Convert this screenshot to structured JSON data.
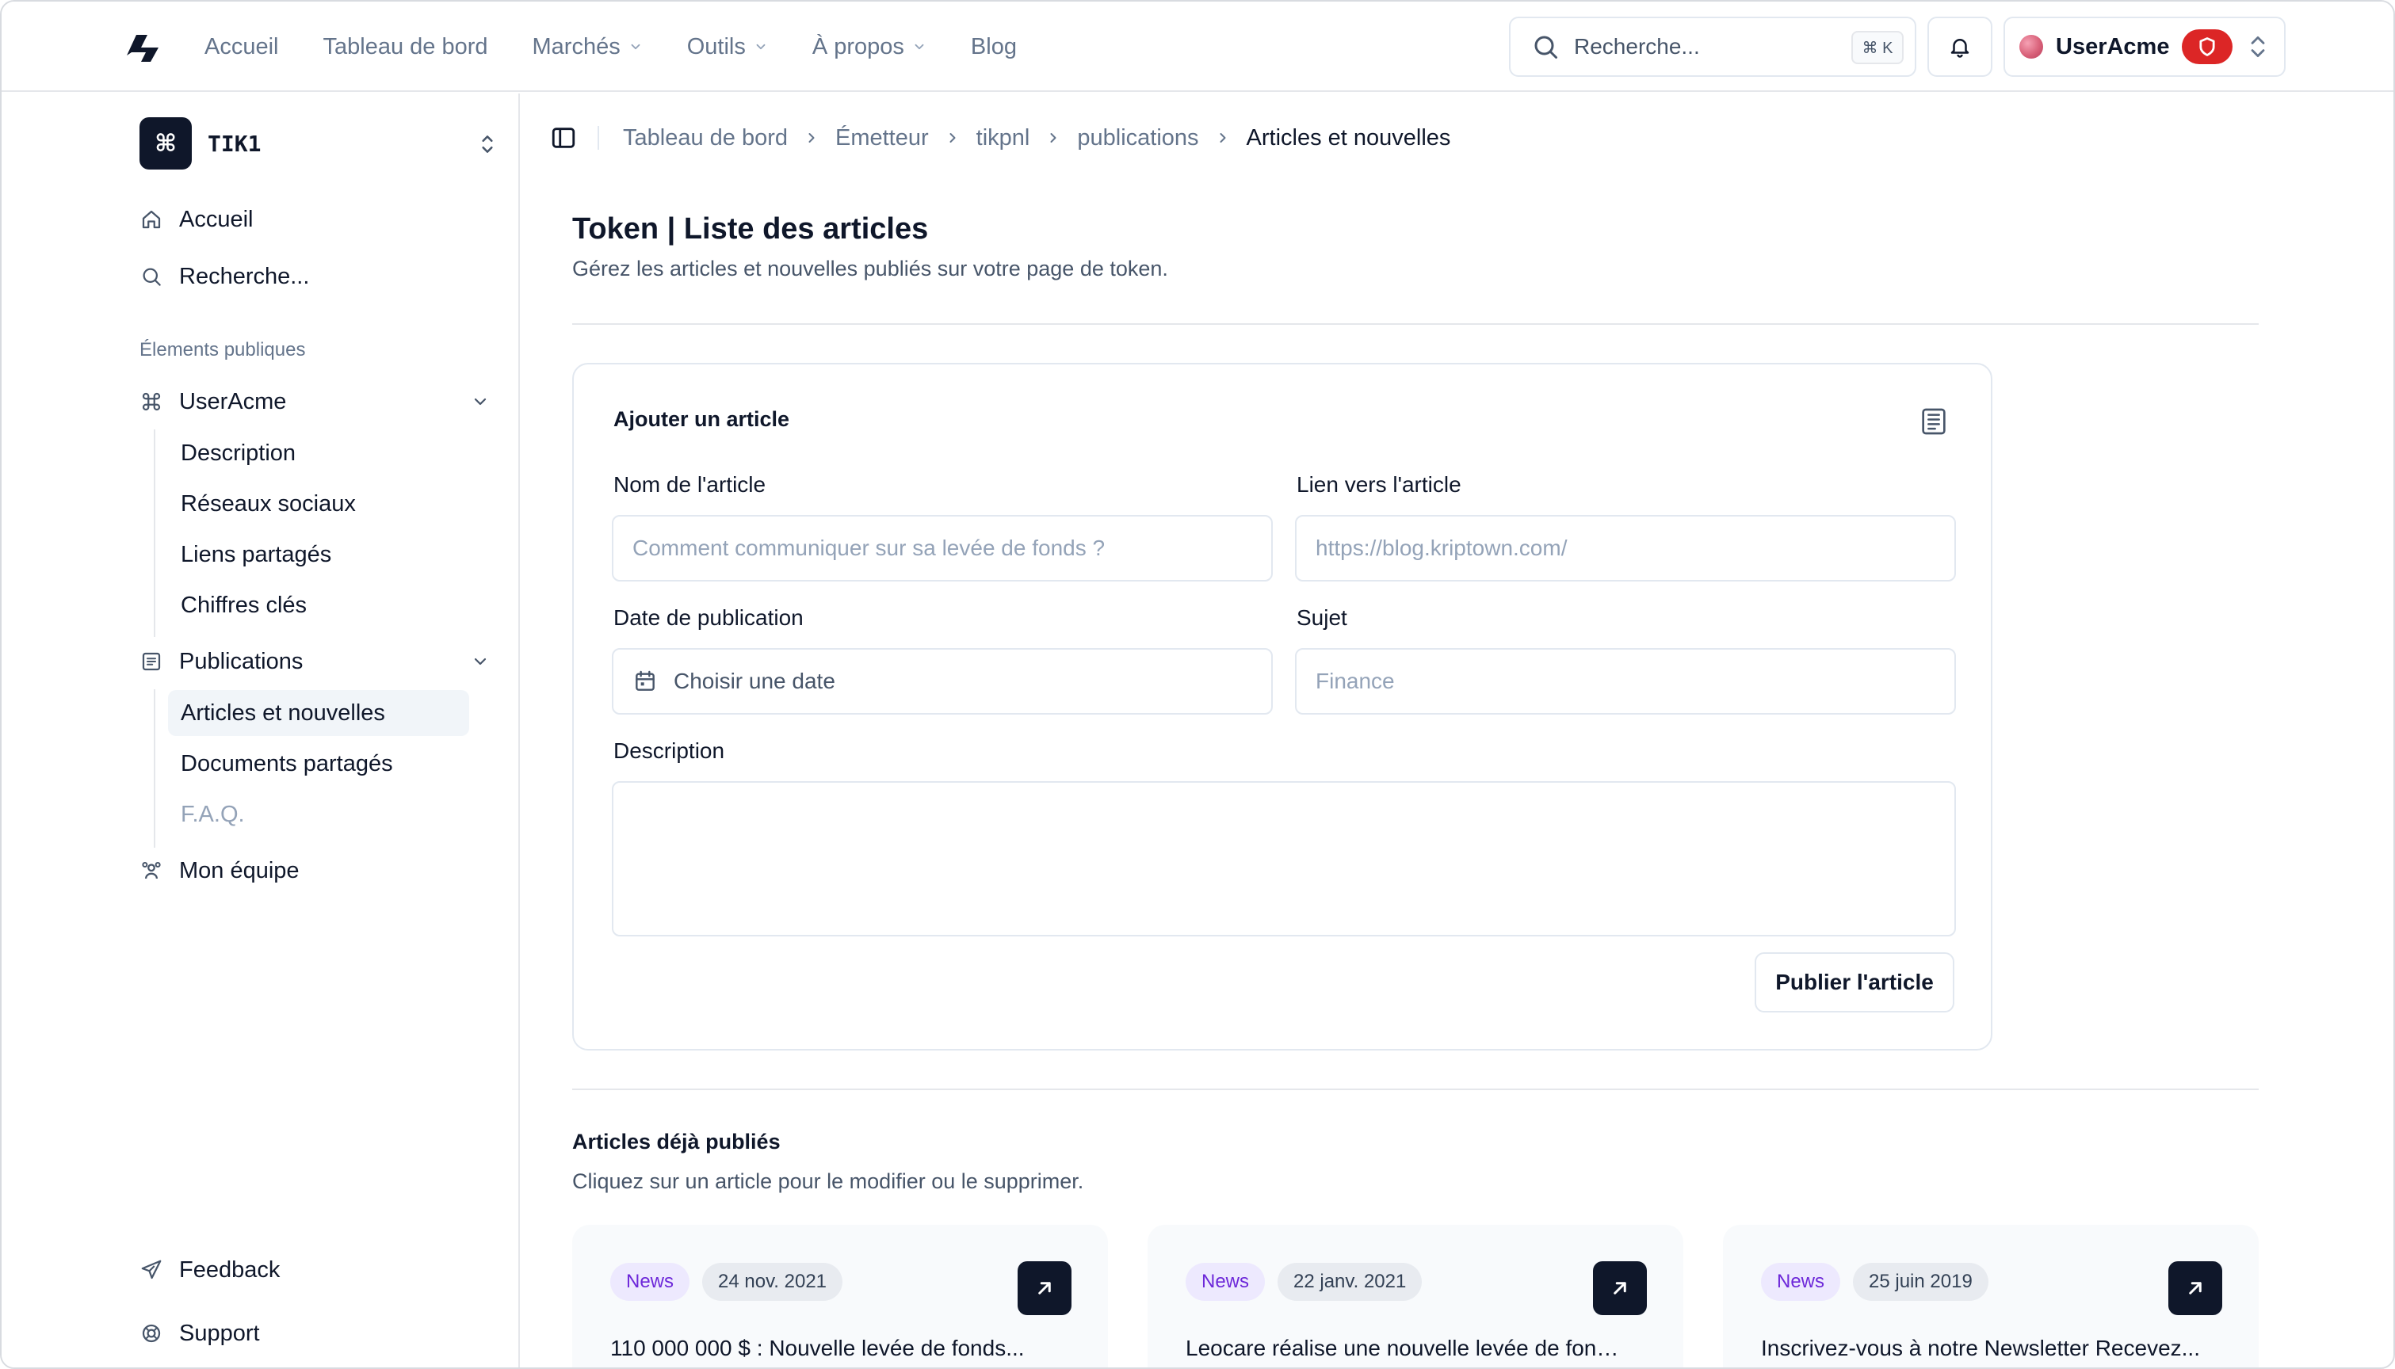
{
  "topnav": {
    "links": [
      {
        "label": "Accueil"
      },
      {
        "label": "Tableau de bord"
      },
      {
        "label": "Marchés"
      },
      {
        "label": "Outils"
      },
      {
        "label": "À propos"
      },
      {
        "label": "Blog"
      }
    ],
    "search_placeholder": "Recherche...",
    "search_shortcut": "⌘ K",
    "user_name": "UserAcme"
  },
  "sidebar": {
    "project_initial": "⌘",
    "project_name": "TIK1",
    "home_label": "Accueil",
    "search_label": "Recherche...",
    "section_label": "Élements publiques",
    "group1": {
      "label": "UserAcme",
      "items": [
        "Description",
        "Réseaux sociaux",
        "Liens partagés",
        "Chiffres clés"
      ]
    },
    "group2": {
      "label": "Publications",
      "items": [
        "Articles et nouvelles",
        "Documents partagés",
        "F.A.Q."
      ]
    },
    "team_label": "Mon équipe",
    "feedback_label": "Feedback",
    "support_label": "Support"
  },
  "breadcrumb": [
    "Tableau de bord",
    "Émetteur",
    "tikpnl",
    "publications",
    "Articles et nouvelles"
  ],
  "page": {
    "title": "Token | Liste des articles",
    "subtitle": "Gérez les articles et nouvelles publiés sur votre page de token."
  },
  "form": {
    "title": "Ajouter un article",
    "name_label": "Nom de l'article",
    "name_placeholder": "Comment communiquer sur sa levée de fonds ?",
    "link_label": "Lien vers l'article",
    "link_placeholder": "https://blog.kriptown.com/",
    "date_label": "Date de publication",
    "date_placeholder": "Choisir une date",
    "subject_label": "Sujet",
    "subject_placeholder": "Finance",
    "description_label": "Description",
    "description_value": "",
    "submit_label": "Publier l'article"
  },
  "published": {
    "title": "Articles déjà publiés",
    "subtitle": "Cliquez sur un article pour le modifier ou le supprimer.",
    "articles": [
      {
        "tag": "News",
        "date": "24 nov. 2021",
        "title": "110 000 000 $ : Nouvelle levée de fonds..."
      },
      {
        "tag": "News",
        "date": "22 janv. 2021",
        "title": "Leocare réalise une nouvelle levée de fonds..."
      },
      {
        "tag": "News",
        "date": "25 juin 2019",
        "title": "Inscrivez-vous à notre Newsletter Recevez..."
      }
    ]
  },
  "colors": {
    "primary": "#0f172a",
    "muted_text": "#64748b",
    "border": "#e2e8f0",
    "badge_news_bg": "#ede9fe",
    "badge_news_text": "#6d28d9",
    "danger": "#dc2626"
  },
  "icons": [
    "logo-icon",
    "chevron-down-icon",
    "search-icon",
    "bell-icon",
    "shield-icon",
    "updown-chevron-icon",
    "home-icon",
    "command-icon",
    "publications-icon",
    "team-icon",
    "sidebar-toggle-icon",
    "chevron-right-icon",
    "article-icon",
    "calendar-icon",
    "arrow-up-right-icon",
    "send-icon",
    "lifebuoy-icon"
  ]
}
